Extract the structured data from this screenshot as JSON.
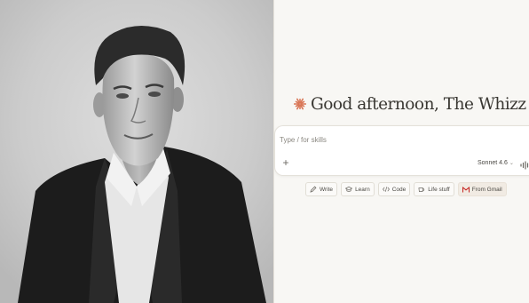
{
  "greeting": {
    "text": "Good afternoon, The Whizz",
    "icon": "claude-spark-icon",
    "icon_color": "#d97757"
  },
  "composer": {
    "placeholder": "Type / for skills",
    "value": "",
    "model_label": "Sonnet 4.6",
    "model_chevron": "⌄",
    "add_icon": "plus-icon",
    "voice_icon": "voice-waveform-icon"
  },
  "chips": [
    {
      "label": "Write",
      "icon": "pencil-icon"
    },
    {
      "label": "Learn",
      "icon": "graduation-cap-icon"
    },
    {
      "label": "Code",
      "icon": "code-brackets-icon"
    },
    {
      "label": "Life stuff",
      "icon": "coffee-cup-icon"
    },
    {
      "label": "From Gmail",
      "icon": "gmail-icon"
    }
  ],
  "colors": {
    "app_background": "#f8f7f4",
    "accent": "#d97757",
    "gmail_chip_background": "#f1ebe3"
  }
}
